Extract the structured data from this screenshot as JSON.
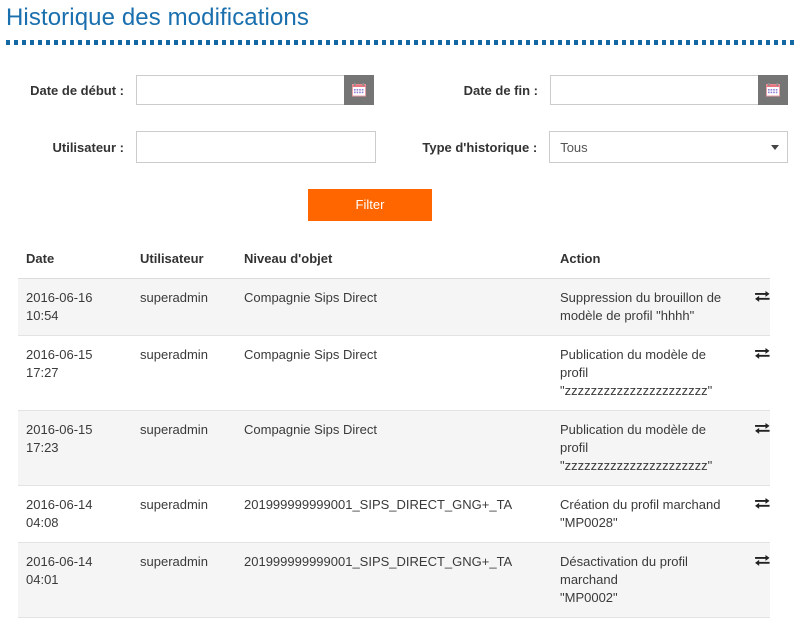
{
  "page": {
    "title": "Historique des modifications",
    "title_color": "#1a6fae",
    "rule_color": "#1369a3"
  },
  "filters": {
    "date_start": {
      "label": "Date de début :",
      "value": "",
      "placeholder": "",
      "calendar_icon": "calendar-icon"
    },
    "date_end": {
      "label": "Date de fin :",
      "value": "",
      "placeholder": "",
      "calendar_icon": "calendar-icon"
    },
    "user": {
      "label": "Utilisateur :",
      "value": "",
      "placeholder": ""
    },
    "history_type": {
      "label": "Type d'historique :",
      "selected": "Tous",
      "caret_icon": "chevron-down-icon"
    },
    "submit": {
      "label": "Filter",
      "color": "#ff6600"
    }
  },
  "table": {
    "columns": [
      "Date",
      "Utilisateur",
      "Niveau d'objet",
      "Action",
      ""
    ],
    "row_icon": "exchange-icon",
    "rows": [
      {
        "date_day": "2016-06-16",
        "date_time": "10:54",
        "user": "superadmin",
        "object_level": "Compagnie Sips Direct",
        "action_line1": "Suppression du brouillon de",
        "action_line2": "modèle de profil \"hhhh\""
      },
      {
        "date_day": "2016-06-15",
        "date_time": "17:27",
        "user": "superadmin",
        "object_level": "Compagnie Sips Direct",
        "action_line1": "Publication du modèle de profil",
        "action_line2": "\"zzzzzzzzzzzzzzzzzzzzzz\""
      },
      {
        "date_day": "2016-06-15",
        "date_time": "17:23",
        "user": "superadmin",
        "object_level": "Compagnie Sips Direct",
        "action_line1": "Publication du modèle de profil",
        "action_line2": "\"zzzzzzzzzzzzzzzzzzzzzz\""
      },
      {
        "date_day": "2016-06-14",
        "date_time": "04:08",
        "user": "superadmin",
        "object_level": "201999999999001_SIPS_DIRECT_GNG+_TA",
        "action_line1": "Création du profil marchand",
        "action_line2": "\"MP0028\""
      },
      {
        "date_day": "2016-06-14",
        "date_time": "04:01",
        "user": "superadmin",
        "object_level": "201999999999001_SIPS_DIRECT_GNG+_TA",
        "action_line1": "Désactivation du profil marchand",
        "action_line2": "\"MP0002\""
      }
    ]
  }
}
